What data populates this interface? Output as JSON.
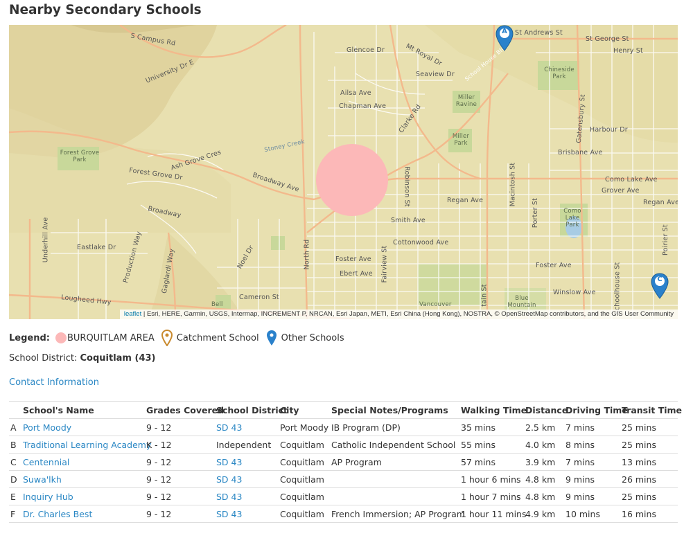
{
  "page": {
    "title": "Nearby Secondary Schools"
  },
  "map": {
    "attribution_link": "leaflet",
    "attribution_text": " | Esri, HERE, Garmin, USGS, Intermap, INCREMENT P, NRCAN, Esri Japan, METI, Esri China (Hong Kong), NOSTRA, © OpenStreetMap contributors, and the GIS User Community",
    "catchment_color": "#fcb8b8",
    "marker_color": "#2a81cb",
    "markers": [
      {
        "letter": "A"
      },
      {
        "letter": "C"
      }
    ],
    "labels": {
      "s_campus_rd": "S Campus Rd",
      "university_dr_e": "University Dr E",
      "glencoe_dr": "Glencoe Dr",
      "mt_royal_dr": "Mt Royal Dr",
      "st_andrews_st": "St Andrews St",
      "st_george_st": "St George St",
      "henry_st": "Henry St",
      "seaview_dr": "Seaview Dr",
      "chineside_park": "Chineside Park",
      "ailsa_ave": "Ailsa Ave",
      "chapman_ave": "Chapman Ave",
      "clarke_rd": "Clarke Rd",
      "miller_ravine": "Miller Ravine",
      "school_house_blvd": "School House Blvd",
      "gatensbury_st": "Gatensbury St",
      "harbour_dr": "Harbour Dr",
      "miller_park": "Miller Park",
      "forest_grove_park": "Forest Grove Park",
      "stoney_creek": "Stoney Creek",
      "ash_grove_cres": "Ash Grove Cres",
      "brisbane_ave": "Brisbane Ave",
      "forest_grove_dr": "Forest Grove Dr",
      "broadway_ave": "Broadway Ave",
      "como_lake_ave": "Como Lake Ave",
      "grover_ave": "Grover Ave",
      "regan_ave": "Regan Ave",
      "regan_ave_2": "Regan Ave",
      "broadway": "Broadway",
      "robinson_st": "Robinson St",
      "macintosh_st": "Macintosh St",
      "porter_st": "Porter St",
      "como_lake_park": "Como Lake Park",
      "smith_ave": "Smith Ave",
      "underhill_ave": "Underhill Ave",
      "eastlake_dr": "Eastlake Dr",
      "production_way": "Production Way",
      "cottonwood_ave": "Cottonwood Ave",
      "noel_dr": "Noel Dr",
      "north_rd": "North Rd",
      "gaglardi_way": "Gaglardi Way",
      "foster_ave": "Foster Ave",
      "foster_ave_2": "Foster Ave",
      "fairview_st": "Fairview St",
      "ebert_ave": "Ebert Ave",
      "schoolhouse_st": "Schoolhouse St",
      "poirier_st": "Poirier St",
      "winslow_ave": "Winslow Ave",
      "lougheed_hwy": "Lougheed Hwy",
      "cameron_st": "Cameron St",
      "blue_mountain": "Blue Mountain",
      "vancouver": "Vancouver",
      "bell": "Bell",
      "tain_st": "tain St"
    }
  },
  "legend": {
    "title": "Legend:",
    "catchment_area": "BURQUITLAM AREA",
    "catchment_school": "Catchment School",
    "other_schools": "Other Schools",
    "catchment_pin_color": "#c98a2e",
    "other_pin_color": "#2a81cb"
  },
  "district": {
    "label": "School District: ",
    "value": "Coquitlam (43)"
  },
  "contact": {
    "label": "Contact Information"
  },
  "table": {
    "headers": [
      "",
      "School's Name",
      "Grades Covered",
      "School District",
      "City",
      "Special Notes/Programs",
      "Walking Time",
      "Distance",
      "Driving Time",
      "Transit Time"
    ],
    "rows": [
      {
        "letter": "A",
        "name": "Port Moody",
        "grades": "9 - 12",
        "district": "SD 43",
        "district_link": true,
        "city": "Port Moody",
        "notes": "IB Program (DP)",
        "walking": "35 mins",
        "distance": "2.5 km",
        "driving": "7 mins",
        "transit": "25 mins"
      },
      {
        "letter": "B",
        "name": "Traditional Learning Academy",
        "grades": "K - 12",
        "district": "Independent",
        "district_link": false,
        "city": "Coquitlam",
        "notes": "Catholic Independent School",
        "walking": "55 mins",
        "distance": "4.0 km",
        "driving": "8 mins",
        "transit": "25 mins"
      },
      {
        "letter": "C",
        "name": "Centennial",
        "grades": "9 - 12",
        "district": "SD 43",
        "district_link": true,
        "city": "Coquitlam",
        "notes": "AP Program",
        "walking": "57 mins",
        "distance": "3.9 km",
        "driving": "7 mins",
        "transit": "13 mins"
      },
      {
        "letter": "D",
        "name": "Suwa'lkh",
        "grades": "9 - 12",
        "district": "SD 43",
        "district_link": true,
        "city": "Coquitlam",
        "notes": "",
        "walking": "1 hour 6 mins",
        "distance": "4.8 km",
        "driving": "9 mins",
        "transit": "26 mins"
      },
      {
        "letter": "E",
        "name": "Inquiry Hub",
        "grades": "9 - 12",
        "district": "SD 43",
        "district_link": true,
        "city": "Coquitlam",
        "notes": "",
        "walking": "1 hour 7 mins",
        "distance": "4.8 km",
        "driving": "9 mins",
        "transit": "25 mins"
      },
      {
        "letter": "F",
        "name": "Dr. Charles Best",
        "grades": "9 - 12",
        "district": "SD 43",
        "district_link": true,
        "city": "Coquitlam",
        "notes": "French Immersion; AP Program",
        "walking": "1 hour 11 mins",
        "distance": "4.9 km",
        "driving": "10 mins",
        "transit": "16 mins"
      }
    ]
  }
}
